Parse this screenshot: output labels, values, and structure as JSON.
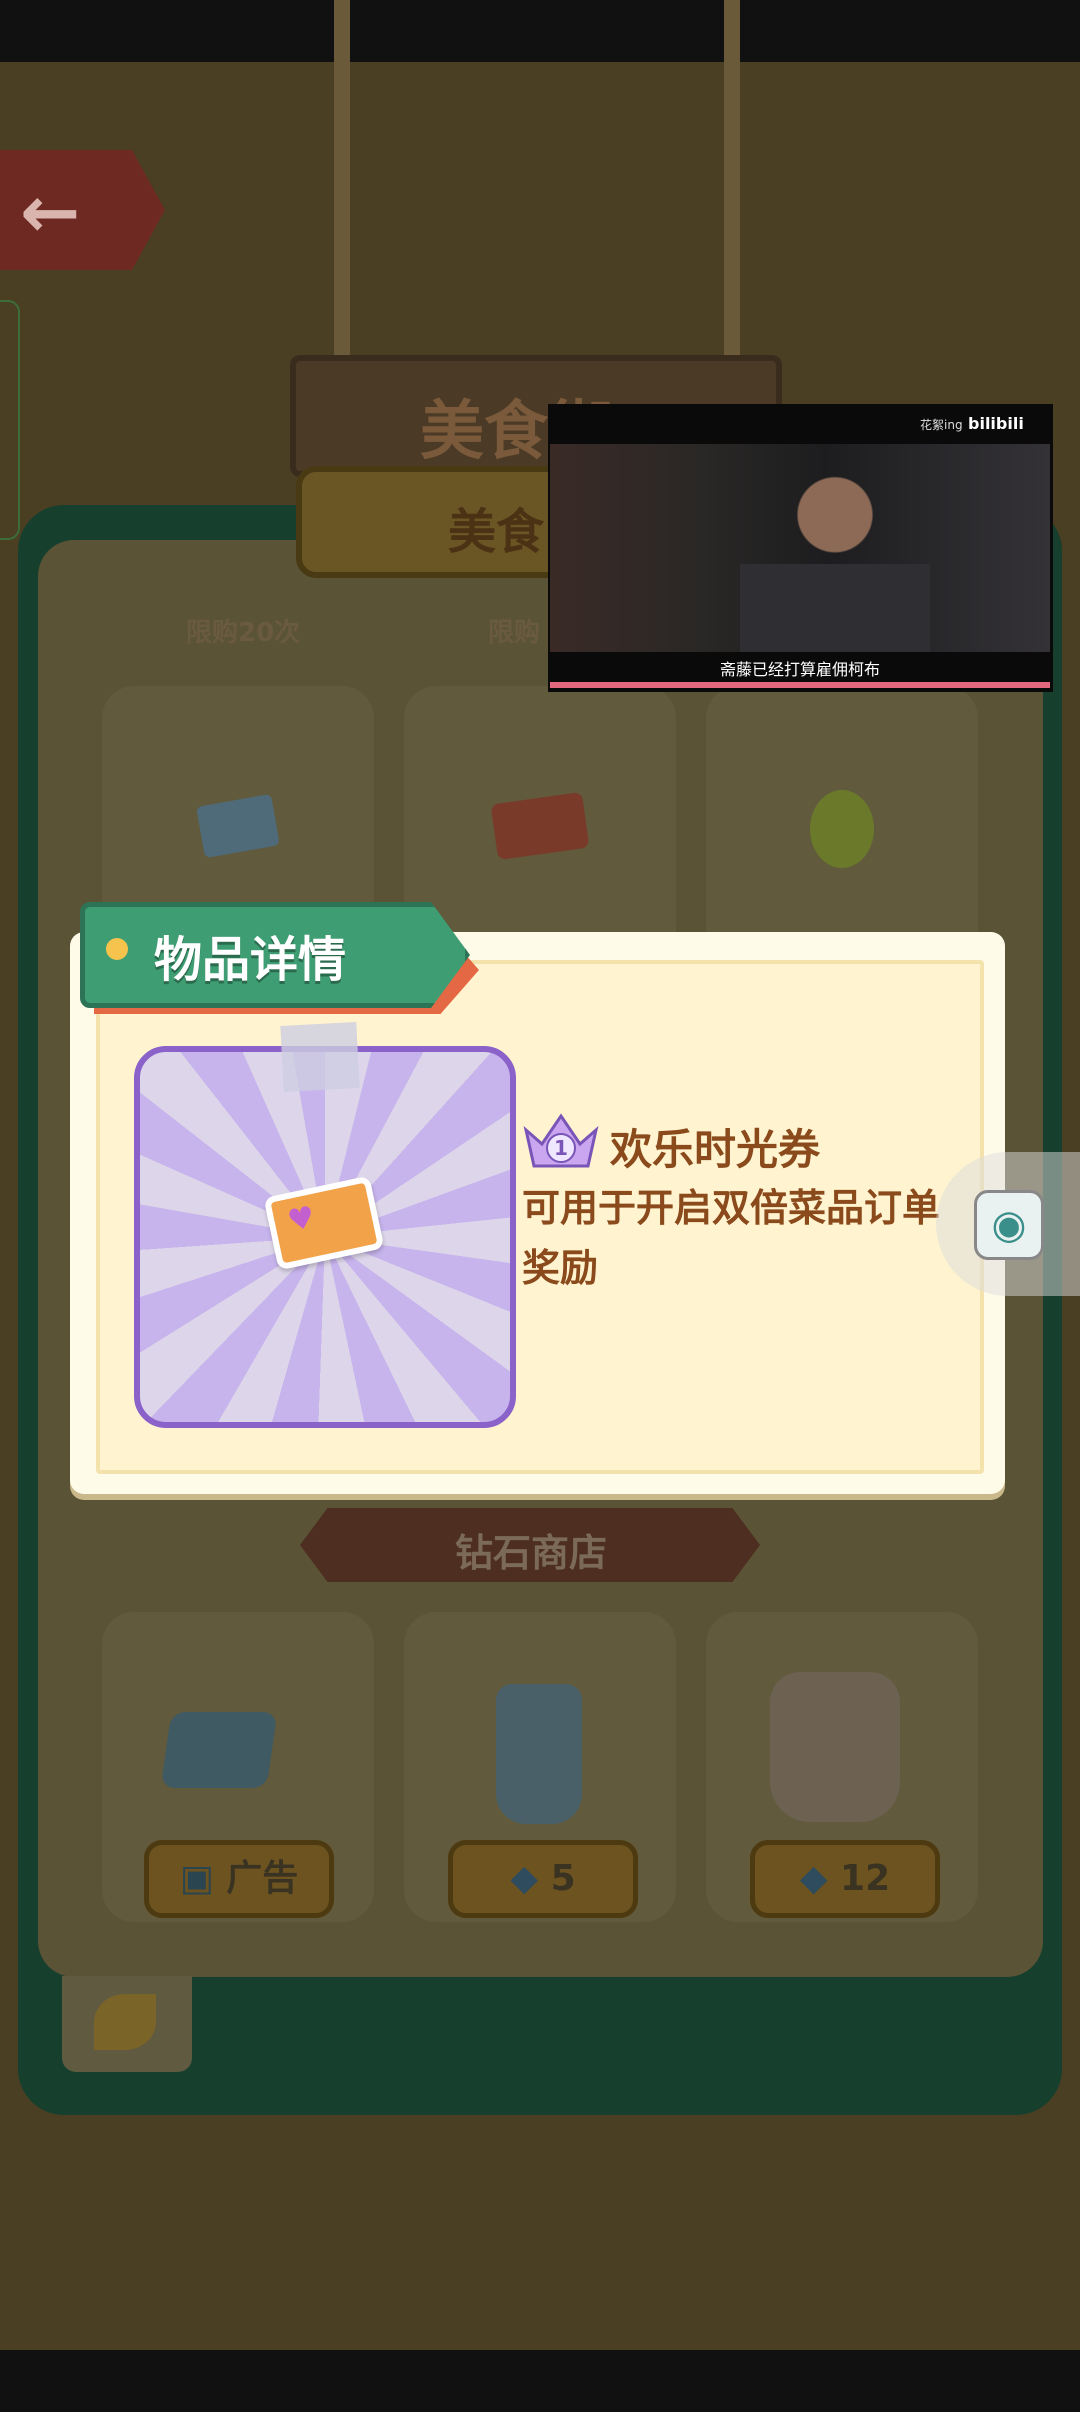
{
  "scene": {
    "sign_text": "美食街",
    "shop_tab_label": "美食",
    "limits": [
      "限购20次",
      "限购"
    ],
    "diamond_shop_label": "钻石商店",
    "items_bottom": [
      {
        "icon": "ice-cube-icon",
        "price_label": "广告",
        "price_icon": "tv-icon"
      },
      {
        "icon": "glass-icon",
        "price_label": "5",
        "price_icon": "diamond-icon"
      },
      {
        "icon": "milk-jug-icon",
        "price_label": "12",
        "price_icon": "diamond-icon"
      }
    ],
    "items_top": [
      {
        "icon": "ticket-icon"
      },
      {
        "icon": "voucher-icon"
      },
      {
        "icon": "avocado-icon"
      }
    ]
  },
  "dialog": {
    "title": "物品详情",
    "item_name": "欢乐时光券",
    "item_level": "1",
    "item_description": "可用于开启双倍菜品订单奖励"
  },
  "video_overlay": {
    "logo": "bilibili",
    "source": "花絮ing",
    "subtitle": "斋藤已经打算雇佣柯布"
  },
  "colors": {
    "accent_green": "#3f9d73",
    "ribbon_orange": "#e46843",
    "frame_purple": "#8b62c9",
    "text_brown": "#8a4a1c"
  }
}
